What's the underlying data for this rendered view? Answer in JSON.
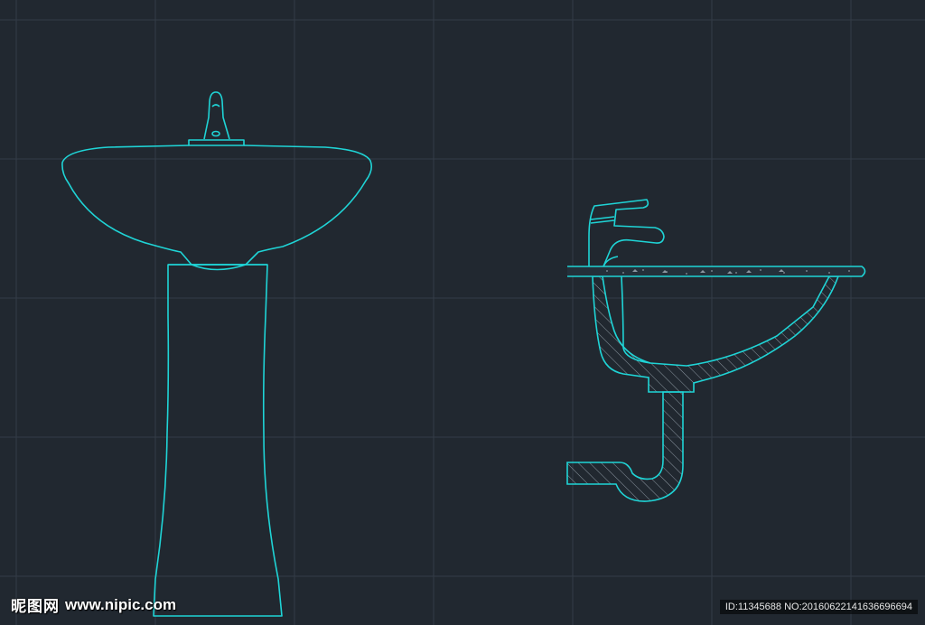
{
  "drawing": {
    "background": "#212830",
    "grid_color": "#3a4350",
    "line_color": "#1fd4d6",
    "hatch_color": "#8b96a0",
    "items": [
      "pedestal-sink-front-elevation",
      "wall-sink-section"
    ]
  },
  "watermark": {
    "brand": "昵图网",
    "site": "www.nipic.com",
    "id_text": "ID:11345688 NO:20160622141636696694"
  }
}
